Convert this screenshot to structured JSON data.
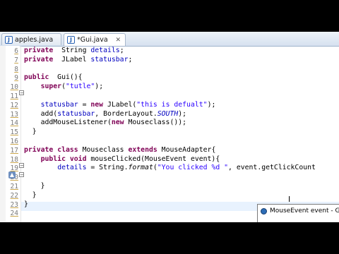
{
  "tabs": [
    {
      "label": "apples.java",
      "active": false
    },
    {
      "label": "*Gui.java",
      "active": true
    }
  ],
  "code_lines": [
    {
      "num": "6",
      "text_parts": [
        [
          "kw",
          "private"
        ],
        [
          "",
          "  String "
        ],
        [
          "fld",
          "details"
        ],
        [
          "",
          ";"
        ]
      ]
    },
    {
      "num": "7",
      "text_parts": [
        [
          "kw",
          "private"
        ],
        [
          "",
          "  JLabel "
        ],
        [
          "fld",
          "statusbar"
        ],
        [
          "",
          ";"
        ]
      ]
    },
    {
      "num": "8",
      "text_parts": []
    },
    {
      "num": "9",
      "text_parts": [
        [
          "kw",
          "public"
        ],
        [
          "",
          "  Gui(){"
        ]
      ]
    },
    {
      "num": "10",
      "text_parts": [
        [
          "",
          "    "
        ],
        [
          "kw",
          "super"
        ],
        [
          "",
          "("
        ],
        [
          "str",
          "\"tutle\""
        ],
        [
          "",
          ");"
        ]
      ]
    },
    {
      "num": "11",
      "text_parts": []
    },
    {
      "num": "12",
      "text_parts": [
        [
          "",
          "    "
        ],
        [
          "fld",
          "statusbar"
        ],
        [
          "",
          " = "
        ],
        [
          "kw",
          "new"
        ],
        [
          "",
          " JLabel("
        ],
        [
          "str",
          "\"this is defualt\""
        ],
        [
          "",
          ");"
        ]
      ]
    },
    {
      "num": "13",
      "text_parts": [
        [
          "",
          "    add("
        ],
        [
          "fld",
          "statusbar"
        ],
        [
          "",
          ", BorderLayout."
        ],
        [
          "sfld",
          "SOUTH"
        ],
        [
          "",
          ");"
        ]
      ]
    },
    {
      "num": "14",
      "text_parts": [
        [
          "",
          "    addMouseListener("
        ],
        [
          "kw",
          "new"
        ],
        [
          "",
          " Mouseclass());"
        ]
      ]
    },
    {
      "num": "15",
      "text_parts": [
        [
          "",
          "  }"
        ]
      ]
    },
    {
      "num": "16",
      "text_parts": []
    },
    {
      "num": "17",
      "text_parts": [
        [
          "kw",
          "private"
        ],
        [
          "",
          " "
        ],
        [
          "kw",
          "class"
        ],
        [
          "",
          " Mouseclass "
        ],
        [
          "kw",
          "extends"
        ],
        [
          "",
          " MouseAdapter{"
        ]
      ]
    },
    {
      "num": "18",
      "text_parts": [
        [
          "",
          "    "
        ],
        [
          "kw",
          "public"
        ],
        [
          "",
          " "
        ],
        [
          "kw",
          "void"
        ],
        [
          "",
          " mouseClicked(MouseEvent event){"
        ]
      ]
    },
    {
      "num": "19",
      "text_parts": [
        [
          "",
          "        "
        ],
        [
          "fld",
          "details"
        ],
        [
          "",
          " = String."
        ],
        [
          "it",
          "format"
        ],
        [
          "",
          "("
        ],
        [
          "str",
          "\"You clicked %d \""
        ],
        [
          "",
          ", event.getClickCount"
        ]
      ]
    },
    {
      "num": "20",
      "text_parts": []
    },
    {
      "num": "21",
      "text_parts": [
        [
          "",
          "    }"
        ]
      ]
    },
    {
      "num": "22",
      "text_parts": [
        [
          "",
          "  }"
        ]
      ]
    },
    {
      "num": "23",
      "text_parts": [
        [
          "",
          "}"
        ]
      ]
    },
    {
      "num": "24",
      "text_parts": []
    }
  ],
  "tooltip": {
    "label": "MouseEvent event - Gui"
  },
  "icons": {
    "java_file": "java-file-icon",
    "close": "close-icon",
    "cursor": "text-cursor-icon"
  }
}
